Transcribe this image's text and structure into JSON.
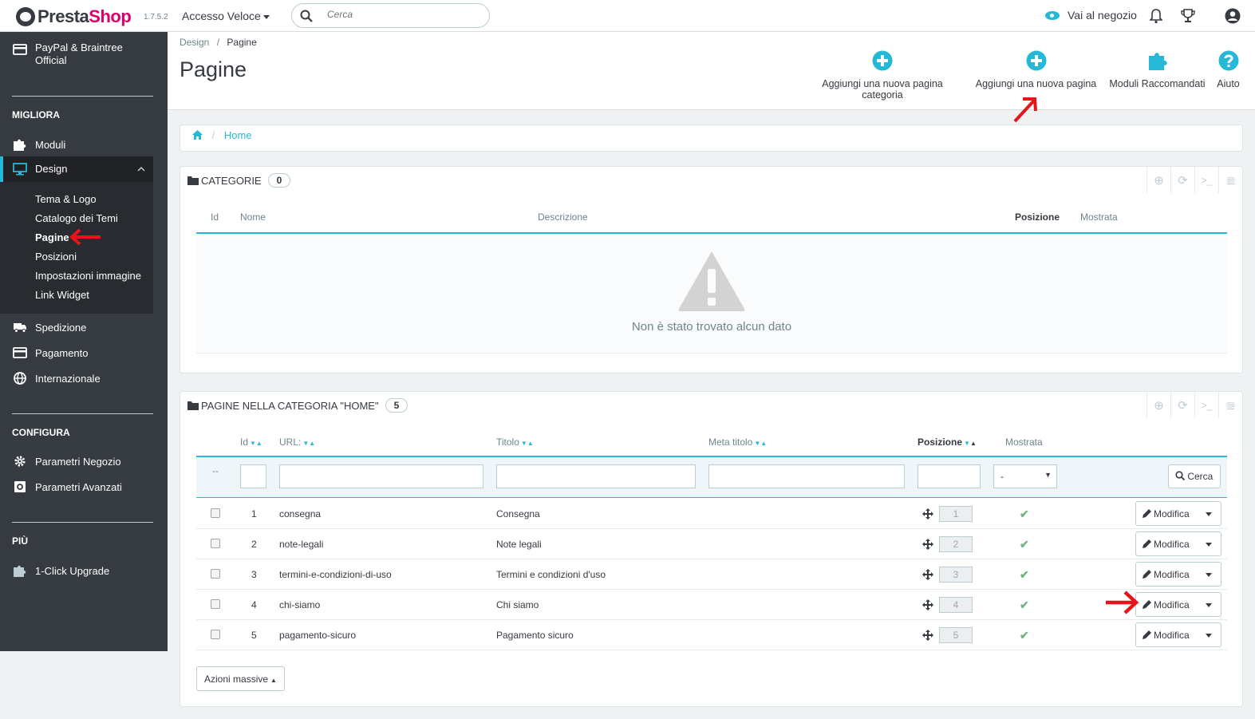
{
  "topbar": {
    "logo_prefix": "Presta",
    "logo_suffix": "Shop",
    "version": "1.7.5.2",
    "quick_access": "Accesso Veloce",
    "search_placeholder": "Cerca",
    "shop_link": "Vai al negozio"
  },
  "sidebar": {
    "top_item": "PayPal & Braintree Official",
    "section1": "MIGLIORA",
    "moduli": "Moduli",
    "design": "Design",
    "design_sub": [
      "Tema & Logo",
      "Catalogo dei Temi",
      "Pagine",
      "Posizioni",
      "Impostazioni immagine",
      "Link Widget"
    ],
    "spedizione": "Spedizione",
    "pagamento": "Pagamento",
    "internazionale": "Internazionale",
    "section2": "CONFIGURA",
    "parametri_negozio": "Parametri Negozio",
    "parametri_avanzati": "Parametri Avanzati",
    "section3": "PIÙ",
    "upgrade": "1-Click Upgrade"
  },
  "header": {
    "breadcrumb_parent": "Design",
    "breadcrumb_sep": "/",
    "breadcrumb_current": "Pagine",
    "title": "Pagine",
    "toolbar": [
      "Aggiungi una nuova pagina categoria",
      "Aggiungi una nuova pagina",
      "Moduli Raccomandati",
      "Aiuto"
    ]
  },
  "path": {
    "home": "Home"
  },
  "categories": {
    "title": "Categorie",
    "count": "0",
    "columns": [
      "Id",
      "Nome",
      "Descrizione",
      "Posizione",
      "Mostrata"
    ],
    "empty_message": "Non è stato trovato alcun dato"
  },
  "pages": {
    "title": "Pagine nella categoria \"Home\"",
    "count": "5",
    "columns": [
      "Id",
      "URL:",
      "Titolo",
      "Meta titolo",
      "Posizione",
      "Mostrata"
    ],
    "filter_dash": "--",
    "filter_select": "-",
    "filter_button": "Cerca",
    "rows": [
      {
        "id": "1",
        "url": "consegna",
        "title": "Consegna",
        "pos": "1"
      },
      {
        "id": "2",
        "url": "note-legali",
        "title": "Note legali",
        "pos": "2"
      },
      {
        "id": "3",
        "url": "termini-e-condizioni-di-uso",
        "title": "Termini e condizioni d'uso",
        "pos": "3"
      },
      {
        "id": "4",
        "url": "chi-siamo",
        "title": "Chi siamo",
        "pos": "4"
      },
      {
        "id": "5",
        "url": "pagamento-sicuro",
        "title": "Pagamento sicuro",
        "pos": "5"
      }
    ],
    "edit_label": "Modifica",
    "bulk_label": "Azioni massive"
  },
  "colors": {
    "accent": "#25b9d7",
    "sidebar": "#363a41",
    "brand": "#df0067",
    "success": "#70b580",
    "annotation": "#e8141b"
  },
  "icons": [
    "search-icon",
    "eye-icon",
    "bell-icon",
    "trophy-icon",
    "user-icon",
    "plus-circle-icon",
    "puzzle-icon",
    "question-icon",
    "home-icon",
    "folder-icon",
    "warning-icon",
    "move-icon",
    "check-icon",
    "pencil-icon"
  ]
}
